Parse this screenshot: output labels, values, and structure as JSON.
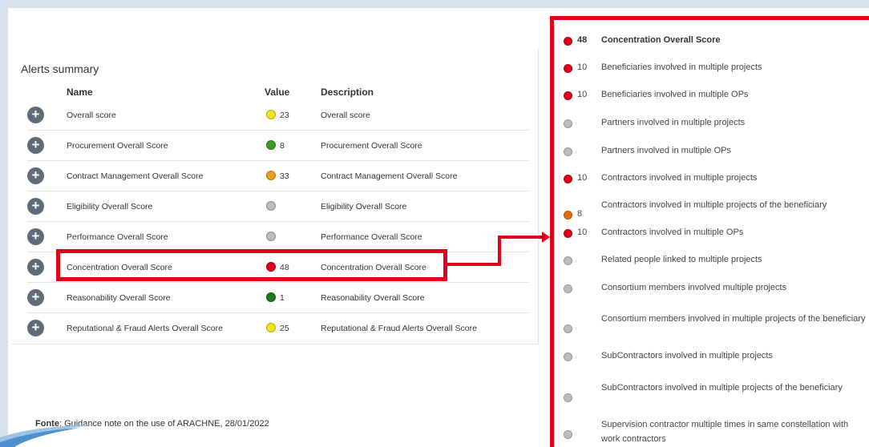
{
  "colors": {
    "yellow": "#f2e31b",
    "green": "#3e9a27",
    "darkgreen": "#1a7a1a",
    "orange": "#e8a01c",
    "darkorange": "#e06a10",
    "red": "#e0001b",
    "grey": "#bdbdbd",
    "highlight": "#e0001b"
  },
  "summary": {
    "title": "Alerts summary",
    "headers": {
      "name": "Name",
      "value": "Value",
      "description": "Description"
    },
    "rows": [
      {
        "name": "Overall score",
        "value": "23",
        "color": "#f2e31b",
        "description": "Overall score"
      },
      {
        "name": "Procurement Overall Score",
        "value": "8",
        "color": "#3e9a27",
        "description": "Procurement Overall Score"
      },
      {
        "name": "Contract Management Overall Score",
        "value": "33",
        "color": "#e8a01c",
        "description": "Contract Management Overall Score"
      },
      {
        "name": "Eligibility Overall Score",
        "value": "",
        "color": "#bdbdbd",
        "description": "Eligibility Overall Score"
      },
      {
        "name": "Performance Overall Score",
        "value": "",
        "color": "#bdbdbd",
        "description": "Performance Overall Score"
      },
      {
        "name": "Concentration Overall Score",
        "value": "48",
        "color": "#e0001b",
        "description": "Concentration Overall Score"
      },
      {
        "name": "Reasonability Overall Score",
        "value": "1",
        "color": "#1a7a1a",
        "description": "Reasonability Overall Score"
      },
      {
        "name": "Reputational & Fraud Alerts Overall Score",
        "value": "25",
        "color": "#f2e31b",
        "description": "Reputational & Fraud Alerts Overall Score"
      }
    ]
  },
  "detail": {
    "items": [
      {
        "value": "48",
        "color": "#e0001b",
        "label": "Concentration Overall Score"
      },
      {
        "value": "10",
        "color": "#e0001b",
        "label": "Beneficiaries involved in multiple projects"
      },
      {
        "value": "10",
        "color": "#e0001b",
        "label": "Beneficiaries involved in multiple OPs"
      },
      {
        "value": "",
        "color": "#bdbdbd",
        "label": "Partners involved in multiple projects"
      },
      {
        "value": "",
        "color": "#bdbdbd",
        "label": "Partners involved in multiple OPs"
      },
      {
        "value": "10",
        "color": "#e0001b",
        "label": "Contractors involved in multiple projects"
      },
      {
        "value": "8",
        "color": "#e06a10",
        "label": "Contractors involved in multiple projects of the beneficiary"
      },
      {
        "value": "10",
        "color": "#e0001b",
        "label": "Contractors involved in multiple OPs"
      },
      {
        "value": "",
        "color": "#bdbdbd",
        "label": "Related people linked to multiple projects"
      },
      {
        "value": "",
        "color": "#bdbdbd",
        "label": "Consortium members involved multiple projects"
      },
      {
        "value": "",
        "color": "#bdbdbd",
        "label": "Consortium members involved in multiple projects of the beneficiary"
      },
      {
        "value": "",
        "color": "#bdbdbd",
        "label": "SubContractors involved in multiple projects"
      },
      {
        "value": "",
        "color": "#bdbdbd",
        "label": "SubContractors involved in multiple projects of the beneficiary"
      },
      {
        "value": "",
        "color": "#bdbdbd",
        "label": "Supervision contractor multiple times in same constellation with work contractors"
      }
    ]
  },
  "footer": {
    "source_label": "Fonte",
    "source_text": ": Guidance note on the use of ARACHNE, 28/01/2022"
  }
}
